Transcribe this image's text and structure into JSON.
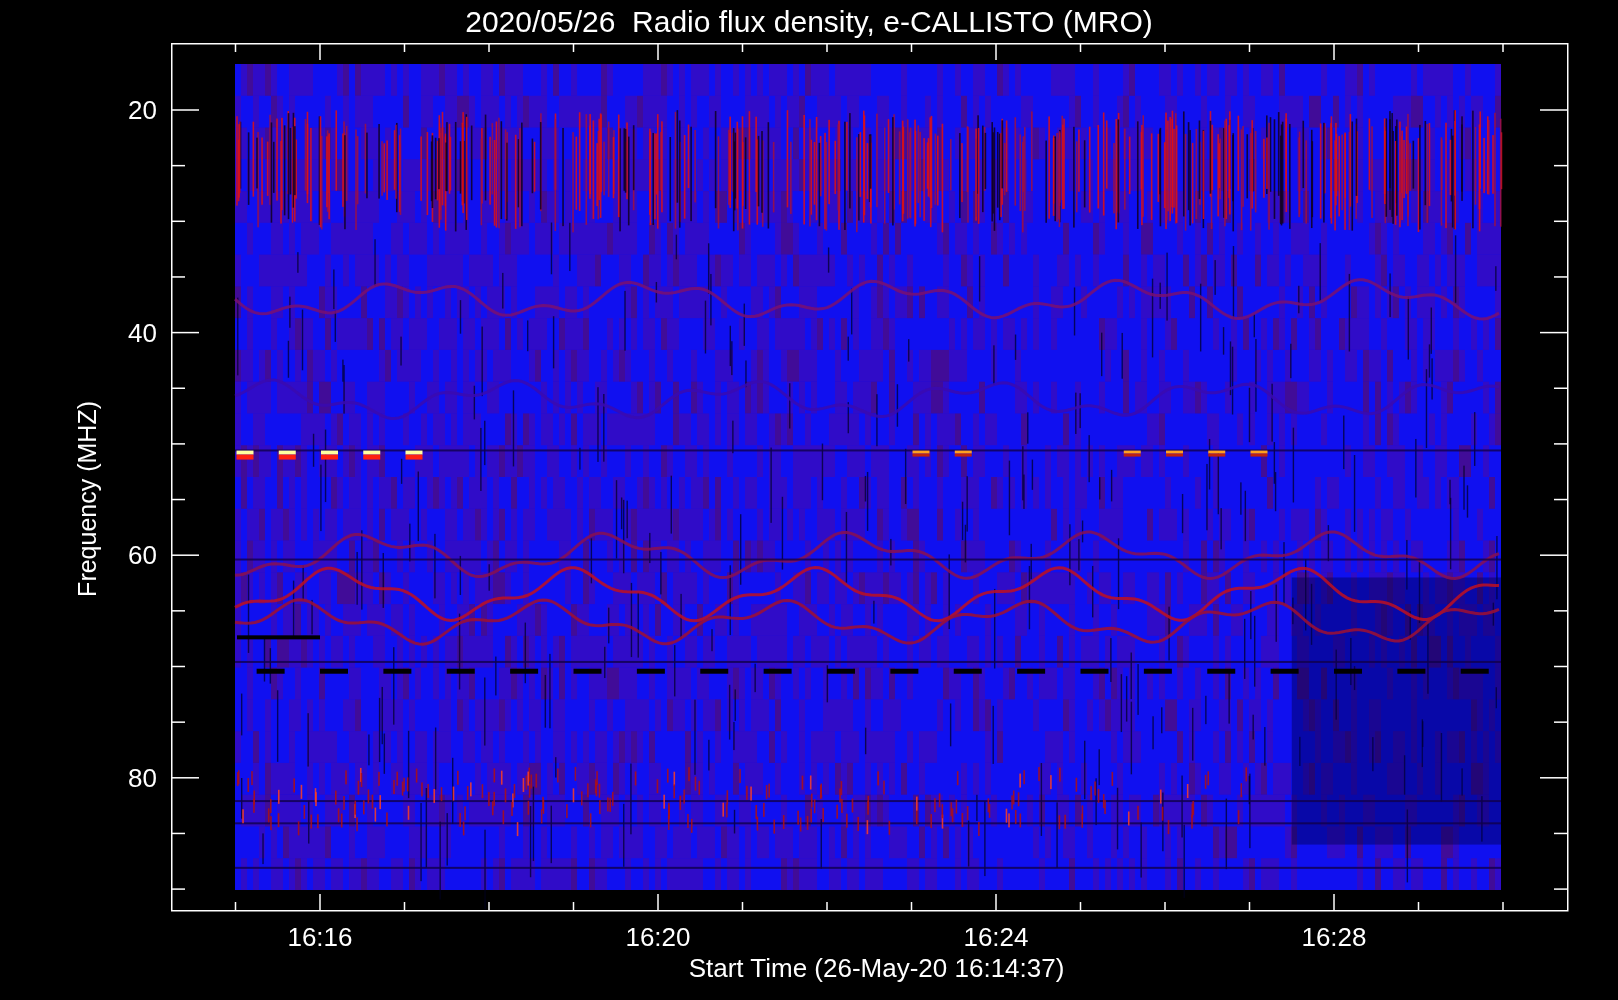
{
  "title": "2020/05/26  Radio flux density, e-CALLISTO (MRO)",
  "y_axis": {
    "label": "Frequency (MHZ)",
    "ticks": [
      "20",
      "40",
      "60",
      "80"
    ]
  },
  "x_axis": {
    "label": "Start Time (26-May-20 16:14:37)",
    "ticks": [
      "16:16",
      "16:20",
      "16:24",
      "16:28"
    ]
  }
}
